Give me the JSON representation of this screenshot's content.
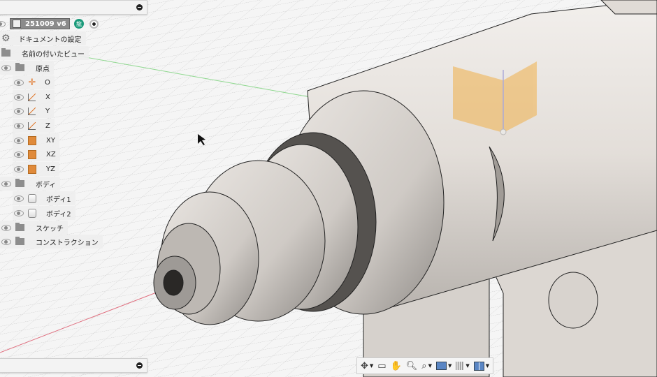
{
  "document": {
    "name": "251009 v6",
    "owner_badge": "龍"
  },
  "browser": {
    "items": [
      {
        "label": "ドキュメントの設定",
        "icon": "gear-icon"
      },
      {
        "label": "名前の付いたビュー",
        "icon": "folder-icon"
      },
      {
        "label": "原点",
        "icon": "folder-icon"
      },
      {
        "label": "O",
        "icon": "origin-point-icon"
      },
      {
        "label": "X",
        "icon": "axis-icon"
      },
      {
        "label": "Y",
        "icon": "axis-icon"
      },
      {
        "label": "Z",
        "icon": "axis-icon"
      },
      {
        "label": "XY",
        "icon": "plane-icon"
      },
      {
        "label": "XZ",
        "icon": "plane-icon"
      },
      {
        "label": "YZ",
        "icon": "plane-icon"
      },
      {
        "label": "ボディ",
        "icon": "folder-icon"
      },
      {
        "label": "ボディ1",
        "icon": "body-icon"
      },
      {
        "label": "ボディ2",
        "icon": "body-icon"
      },
      {
        "label": "スケッチ",
        "icon": "folder-icon"
      },
      {
        "label": "コンストラクション",
        "icon": "folder-icon"
      }
    ]
  },
  "toolbar": {
    "tools": [
      "orbit-icon",
      "look-at-icon",
      "pan-icon",
      "zoom-icon",
      "fit-icon",
      "display-settings-icon",
      "grid-icon",
      "viewports-icon"
    ]
  },
  "colors": {
    "accent": "#e08a3a",
    "badge": "#1a9a7a",
    "model": "#e6e1dc"
  }
}
